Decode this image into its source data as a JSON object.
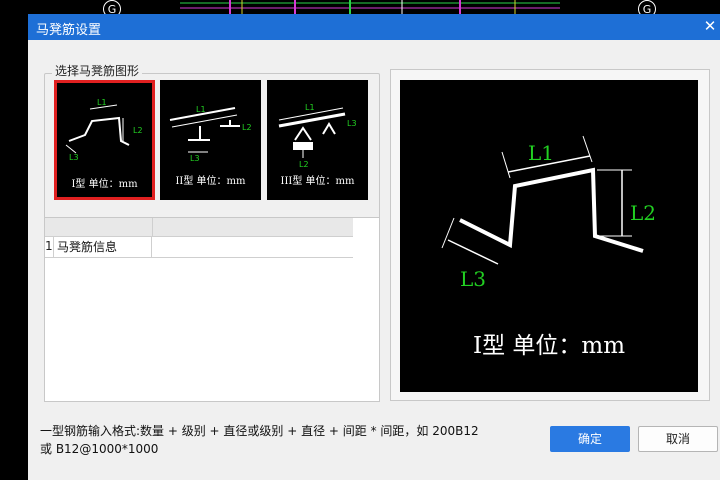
{
  "background": {
    "grid_marker_left": "G",
    "grid_marker_right": "G"
  },
  "dialog": {
    "title": "马凳筋设置",
    "close_icon": "close-icon"
  },
  "shape_group": {
    "legend": "选择马凳筋图形",
    "options": [
      {
        "label": "I型 单位：mm",
        "selected": true,
        "dims": [
          "L1",
          "L2",
          "L3"
        ]
      },
      {
        "label": "II型 单位：mm",
        "selected": false,
        "dims": [
          "L1",
          "L2",
          "L3"
        ]
      },
      {
        "label": "III型 单位：mm",
        "selected": false,
        "dims": [
          "L1",
          "L2",
          "L3"
        ]
      }
    ]
  },
  "grid": {
    "rows": [
      {
        "index": "1",
        "name": "马凳筋信息",
        "value": ""
      }
    ]
  },
  "preview": {
    "label": "I型  单位：mm",
    "dims": [
      "L1",
      "L2",
      "L3"
    ]
  },
  "hint": {
    "line1": "一型钢筋输入格式:数量 + 级别 + 直径或级别 + 直径 + 间距 * 间距，如 200B12",
    "line2": "或 B12@1000*1000"
  },
  "buttons": {
    "ok": "确定",
    "cancel": "取消"
  },
  "colors": {
    "titlebar": "#1e6fd6",
    "selected_border": "#e02020",
    "dimension_text": "#22d022",
    "ok_button": "#2a7ae2"
  }
}
